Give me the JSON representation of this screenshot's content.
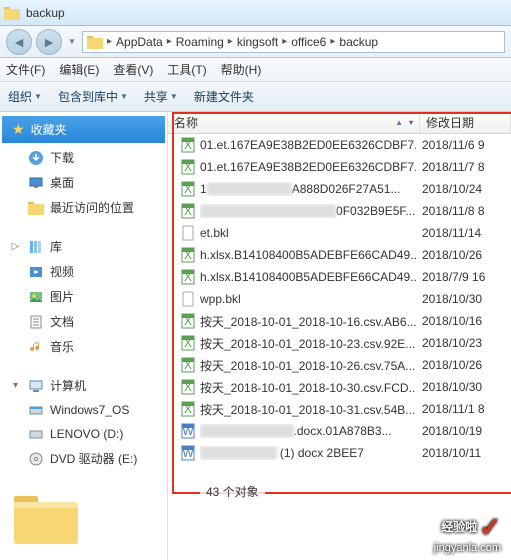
{
  "window": {
    "title": "backup"
  },
  "breadcrumb": [
    "AppData",
    "Roaming",
    "kingsoft",
    "office6",
    "backup"
  ],
  "menu": {
    "file": "文件(F)",
    "edit": "编辑(E)",
    "view": "查看(V)",
    "tools": "工具(T)",
    "help": "帮助(H)"
  },
  "toolbar": {
    "organize": "组织",
    "include": "包含到库中",
    "share": "共享",
    "newfolder": "新建文件夹"
  },
  "columns": {
    "name": "名称",
    "date": "修改日期"
  },
  "sidebar": {
    "favorites": "收藏夹",
    "downloads": "下载",
    "desktop": "桌面",
    "recent": "最近访问的位置",
    "libraries": "库",
    "videos": "视频",
    "pictures": "图片",
    "documents": "文档",
    "music": "音乐",
    "computer": "计算机",
    "drive_c": "Windows7_OS",
    "drive_d": "LENOVO (D:)",
    "drive_e": "DVD 驱动器 (E:)"
  },
  "files": [
    {
      "icon": "xls",
      "name": "01.et.167EA9E38B2ED0EE6326CDBF7...",
      "date": "2018/11/6 9"
    },
    {
      "icon": "xls",
      "name": "01.et.167EA9E38B2ED0EE6326CDBF7...",
      "date": "2018/11/7 8"
    },
    {
      "icon": "xls",
      "name": "1██████████A888D026F27A51...",
      "date": "2018/10/24"
    },
    {
      "icon": "xls",
      "name": "████████████████0F032B9E5F...",
      "date": "2018/11/8 8"
    },
    {
      "icon": "blank",
      "name": "et.bkl",
      "date": "2018/11/14"
    },
    {
      "icon": "xls",
      "name": "h.xlsx.B14108400B5ADEBFE66CAD49...",
      "date": "2018/10/26"
    },
    {
      "icon": "xls",
      "name": "h.xlsx.B14108400B5ADEBFE66CAD49...",
      "date": "2018/7/9 16"
    },
    {
      "icon": "blank",
      "name": "wpp.bkl",
      "date": "2018/10/30"
    },
    {
      "icon": "xls",
      "name": "按天_2018-10-01_2018-10-16.csv.AB6...",
      "date": "2018/10/16"
    },
    {
      "icon": "xls",
      "name": "按天_2018-10-01_2018-10-23.csv.92E...",
      "date": "2018/10/23"
    },
    {
      "icon": "xls",
      "name": "按天_2018-10-01_2018-10-26.csv.75A...",
      "date": "2018/10/26"
    },
    {
      "icon": "xls",
      "name": "按天_2018-10-01_2018-10-30.csv.FCD...",
      "date": "2018/10/30"
    },
    {
      "icon": "xls",
      "name": "按天_2018-10-01_2018-10-31.csv.54B...",
      "date": "2018/11/1 8"
    },
    {
      "icon": "doc",
      "name": "███████████.docx.01A878B3...",
      "date": "2018/10/19"
    },
    {
      "icon": "doc",
      "name": "█████████ (1) docx 2BEE7",
      "date": "2018/10/11"
    }
  ],
  "status": {
    "objects": "43 个对象"
  },
  "watermark": {
    "brand": "经验啦",
    "url": "jingyanla.com"
  }
}
